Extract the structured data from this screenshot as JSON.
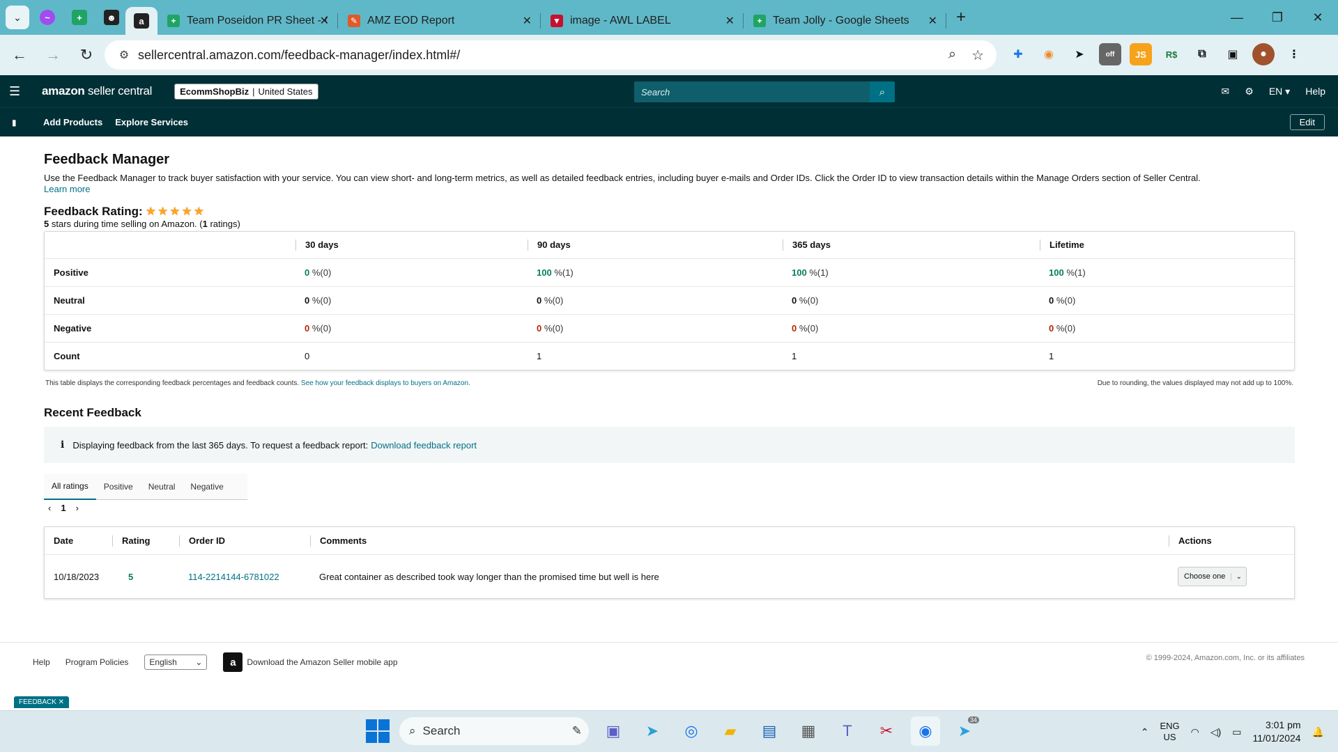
{
  "browser": {
    "tabs": [
      {
        "title": "Team Poseidon PR Sheet - Goo",
        "icon": "sheets-icon"
      },
      {
        "title": "AMZ EOD Report",
        "icon": "pencil-icon"
      },
      {
        "title": "image - AWL LABEL",
        "icon": "label-icon"
      },
      {
        "title": "Team Jolly - Google Sheets",
        "icon": "sheets-icon"
      }
    ],
    "url": "sellercentral.amazon.com/feedback-manager/index.html#/"
  },
  "header": {
    "logo_brand": "amazon",
    "logo_product": "seller central",
    "store_name": "EcommShopBiz",
    "store_region": "United States",
    "search_placeholder": "Search",
    "language": "EN",
    "help": "Help"
  },
  "subnav": {
    "links": [
      "Add Products",
      "Explore Services"
    ],
    "edit": "Edit"
  },
  "page": {
    "title": "Feedback Manager",
    "intro": "Use the Feedback Manager to track buyer satisfaction with your service. You can view short- and long-term metrics, as well as detailed feedback entries, including buyer e-mails and Order IDs. Click the Order ID to view transaction details within the Manage Orders section of Seller Central.",
    "learn_more": "Learn more",
    "rating_label": "Feedback Rating:",
    "stars": 5,
    "rating_stars_value": "5",
    "rating_text": " stars during time selling on Amazon. (",
    "rating_count": "1",
    "rating_suffix": " ratings)"
  },
  "metrics": {
    "columns": [
      "30 days",
      "90 days",
      "365 days",
      "Lifetime"
    ],
    "rows": [
      {
        "label": "Positive",
        "cells": [
          [
            "0",
            " %(0)"
          ],
          [
            "100",
            " %(1)"
          ],
          [
            "100",
            " %(1)"
          ],
          [
            "100",
            " %(1)"
          ]
        ]
      },
      {
        "label": "Neutral",
        "cells": [
          [
            "0",
            " %(0)"
          ],
          [
            "0",
            " %(0)"
          ],
          [
            "0",
            " %(0)"
          ],
          [
            "0",
            " %(0)"
          ]
        ]
      },
      {
        "label": "Negative",
        "cells": [
          [
            "0",
            " %(0)"
          ],
          [
            "0",
            " %(0)"
          ],
          [
            "0",
            " %(0)"
          ],
          [
            "0",
            " %(0)"
          ]
        ]
      },
      {
        "label": "Count",
        "cells": [
          [
            "0",
            ""
          ],
          [
            "1",
            ""
          ],
          [
            "1",
            ""
          ],
          [
            "1",
            ""
          ]
        ]
      }
    ],
    "note": "This table displays the corresponding feedback percentages and feedback counts.",
    "note_link": "See how your feedback displays to buyers on Amazon.",
    "rounding_note": "Due to rounding, the values displayed may not add up to 100%."
  },
  "recent": {
    "title": "Recent Feedback",
    "info": "Displaying feedback from the last 365 days. To request a feedback report:",
    "info_link": "Download feedback report",
    "tabs": [
      "All ratings",
      "Positive",
      "Neutral",
      "Negative"
    ],
    "page": "1",
    "columns": [
      "Date",
      "Rating",
      "Order ID",
      "Comments",
      "Actions"
    ],
    "rows": [
      {
        "date": "10/18/2023",
        "rating": "5",
        "order_id": "114-2214144-6781022",
        "comment": "Great container as described took way longer than the promised time but well is here",
        "action": "Choose one"
      }
    ]
  },
  "footer": {
    "help": "Help",
    "policies": "Program Policies",
    "language": "English",
    "app_text": "Download the Amazon Seller mobile app",
    "copyright": "© 1999-2024, Amazon.com, Inc. or its affiliates",
    "feedback_badge": "FEEDBACK ✕"
  },
  "taskbar": {
    "search": "Search",
    "lang_top": "ENG",
    "lang_bottom": "US",
    "time": "3:01 pm",
    "date": "11/01/2024",
    "telegram_badge": "34"
  },
  "colors": {
    "amazon_header": "#002f36",
    "positive": "#067d62",
    "negative": "#b12704",
    "link": "#007185",
    "star": "#ffa41c"
  }
}
